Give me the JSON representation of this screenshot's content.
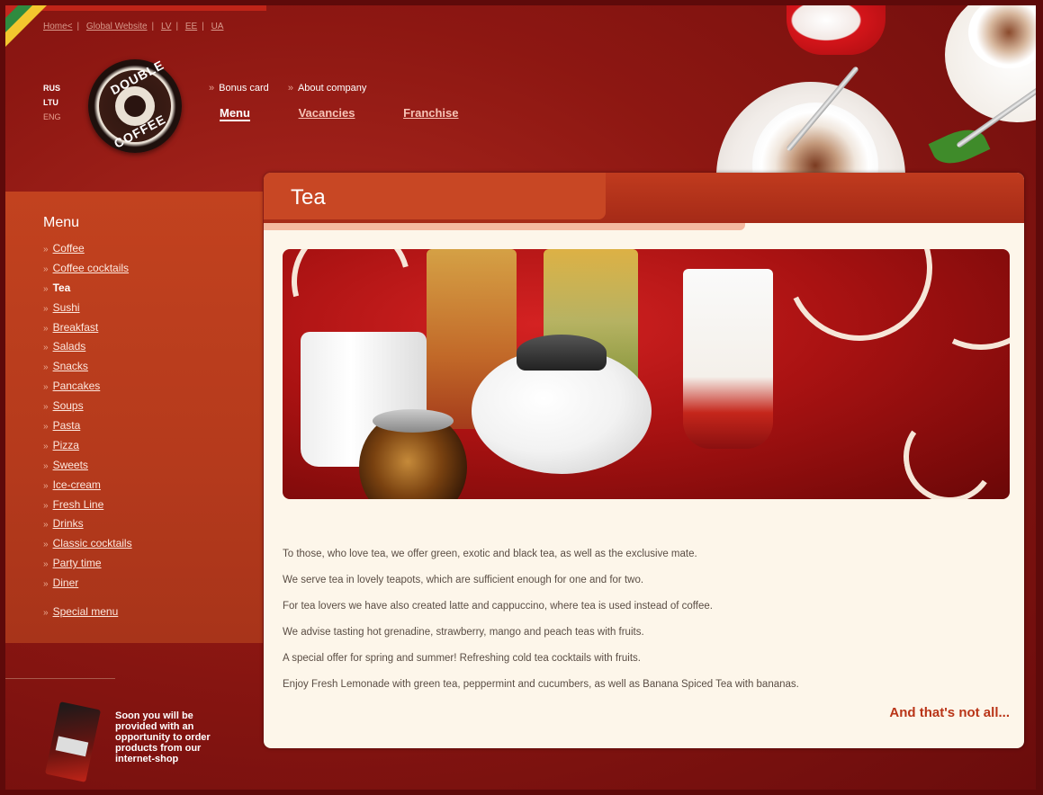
{
  "top_links": [
    "Home<",
    "Global Website",
    "LV",
    "EE",
    "UA"
  ],
  "languages": [
    "RUS",
    "LTU",
    "ENG"
  ],
  "logo": {
    "line1": "DOUBLE",
    "line2": "COFFEE"
  },
  "nav_small": [
    "Bonus card",
    "About company"
  ],
  "nav_main": [
    "Menu",
    "Vacancies",
    "Franchise"
  ],
  "sidebar": {
    "title": "Menu",
    "items": [
      "Coffee",
      "Coffee cocktails",
      "Tea",
      "Sushi",
      "Breakfast",
      "Salads",
      "Snacks",
      "Pancakes",
      "Soups",
      "Pasta",
      "Pizza",
      "Sweets",
      "Ice-cream",
      "Fresh Line",
      "Drinks",
      "Classic cocktails",
      "Party time",
      "Diner"
    ],
    "active": "Tea",
    "special": "Special menu"
  },
  "shop_promo": "Soon you will be provided with an opportunity to order products from our internet-shop",
  "content": {
    "title": "Tea",
    "paragraphs": [
      "To those, who love tea, we offer green, exotic and black tea, as well as the exclusive mate.",
      "We serve tea in lovely teapots, which are sufficient enough for one and for two.",
      "For tea lovers we have also created latte and cappuccino, where tea is used instead of coffee.",
      "We advise tasting hot grenadine, strawberry, mango and peach teas with fruits.",
      "A special offer for spring and summer! Refreshing cold tea cocktails with fruits.",
      "Enjoy Fresh Lemonade with green tea, peppermint and cucumbers, as well as Banana Spiced Tea with bananas."
    ],
    "more_link": "And that's not all..."
  },
  "colors": {
    "background": "#8d1712",
    "sidebar": "#c2421f",
    "panel": "#fdf6ea",
    "accent": "#b93417"
  }
}
